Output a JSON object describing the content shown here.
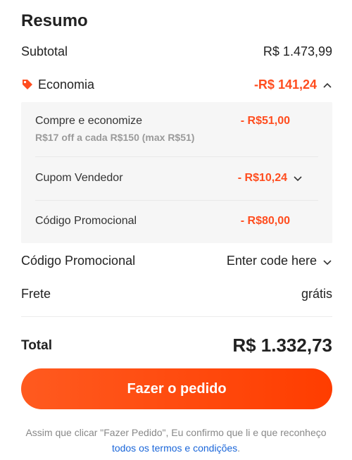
{
  "summary": {
    "title": "Resumo",
    "subtotal_label": "Subtotal",
    "subtotal_value": "R$ 1.473,99",
    "economy_label": "Economia",
    "economy_value": "-R$ 141,24",
    "panel": {
      "items": [
        {
          "label": "Compre e economize",
          "sub": "R$17 off a cada R$150 (max R$51)",
          "amount": "- R$51,00"
        },
        {
          "label": "Cupom Vendedor",
          "amount": "- R$10,24"
        },
        {
          "label": "Código Promocional",
          "amount": "- R$80,00"
        }
      ]
    },
    "promo_label": "Código Promocional",
    "promo_value": "Enter code here",
    "shipping_label": "Frete",
    "shipping_value": "grátis",
    "total_label": "Total",
    "total_value": "R$ 1.332,73"
  },
  "actions": {
    "place_order_label": "Fazer o pedido"
  },
  "legal": {
    "text_before": "Assim que clicar \"Fazer Pedido\", Eu confirmo que li e que reconheço ",
    "link_text": "todos os termos e condições",
    "text_after": "."
  },
  "colors": {
    "accent": "#ff4d1f",
    "link": "#1a66d9",
    "panel_bg": "#f6f6f6"
  },
  "icons": {
    "economy_tag": "tag-icon",
    "economy_toggle": "chevron-up-icon",
    "seller_coupon_toggle": "chevron-down-icon",
    "promo_toggle": "chevron-down-icon"
  }
}
